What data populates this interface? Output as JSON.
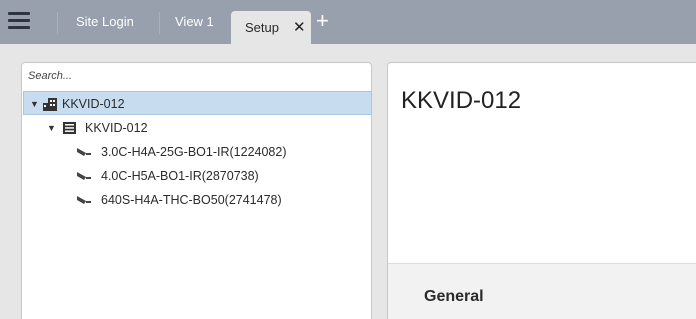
{
  "toolbar": {
    "menu_icon": "hamburger-menu-icon",
    "tabs": [
      {
        "label": "Site Login"
      },
      {
        "label": "View 1"
      },
      {
        "label": "Setup",
        "close": "✕",
        "active": true
      }
    ],
    "add_tab": "+"
  },
  "tree": {
    "search_placeholder": "Search...",
    "items": [
      {
        "label": "KKVID-012",
        "icon": "site-building-icon",
        "expanded": true,
        "selected": true
      },
      {
        "label": "KKVID-012",
        "icon": "server-icon",
        "expanded": true
      },
      {
        "label": "3.0C-H4A-25G-BO1-IR(1224082)",
        "icon": "camera-icon"
      },
      {
        "label": "4.0C-H5A-BO1-IR(2870738)",
        "icon": "camera-icon"
      },
      {
        "label": "640S-H4A-THC-BO50(2741478)",
        "icon": "camera-icon"
      }
    ]
  },
  "detail": {
    "title": "KKVID-012",
    "section": "General"
  }
}
